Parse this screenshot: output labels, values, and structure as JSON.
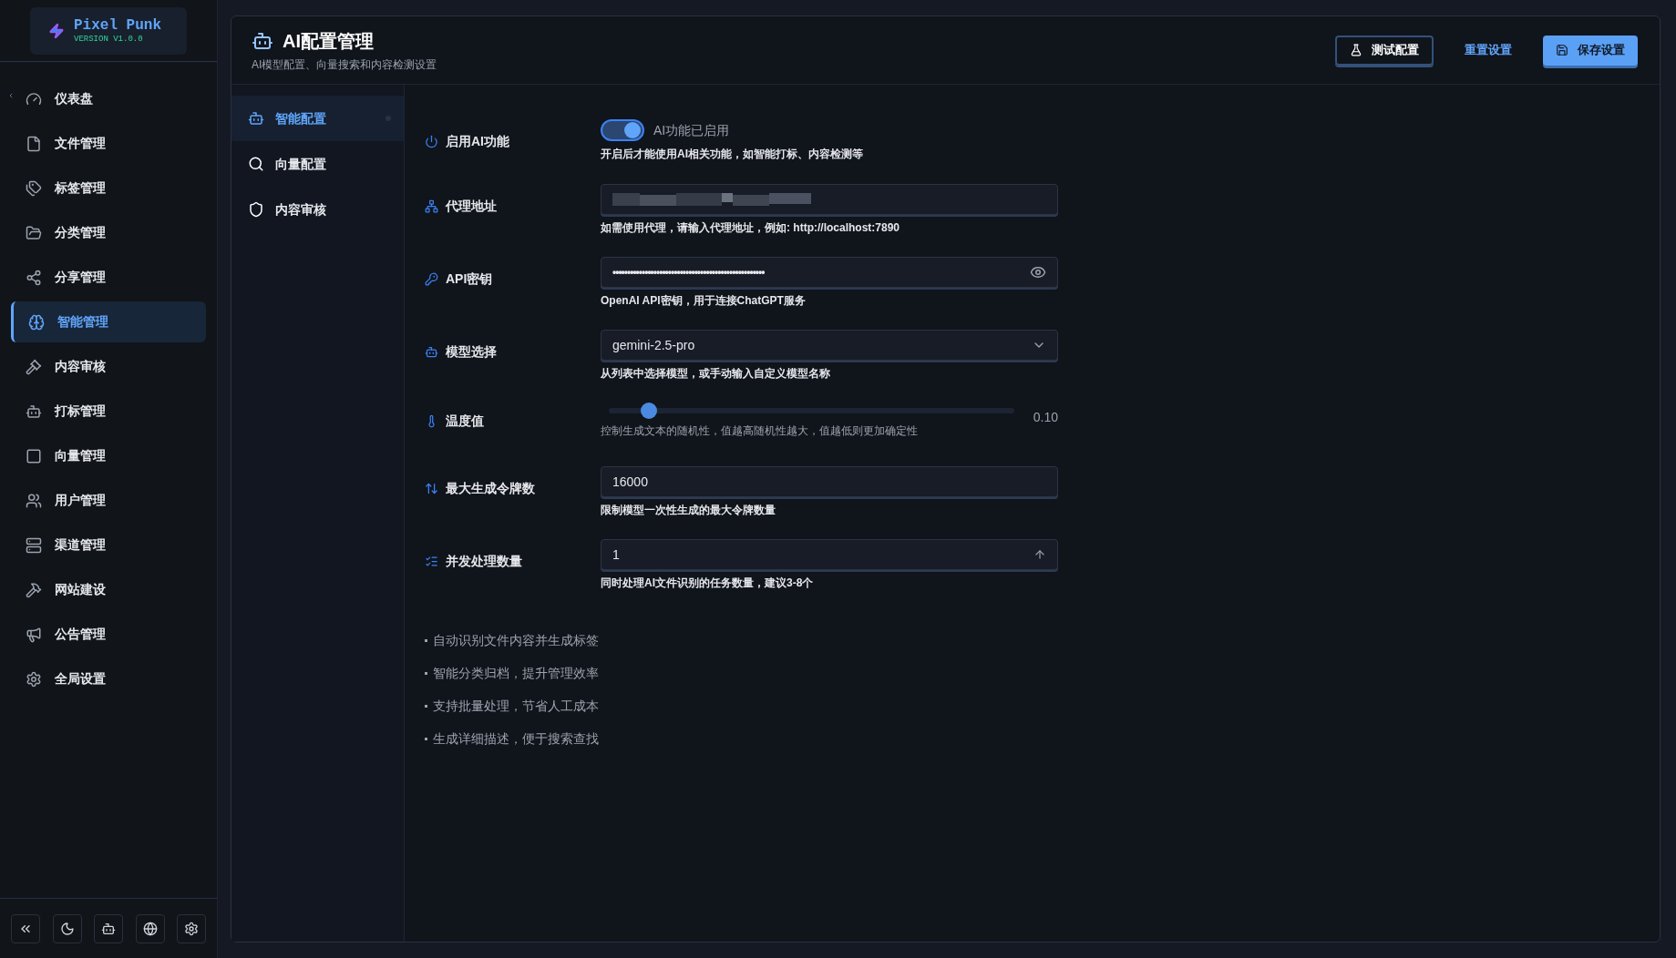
{
  "logo": {
    "name": "Pixel Punk",
    "version": "VERSION V1.0.0"
  },
  "sidebar": {
    "items": [
      {
        "label": "仪表盘",
        "selected": false
      },
      {
        "label": "文件管理",
        "selected": false
      },
      {
        "label": "标签管理",
        "selected": false
      },
      {
        "label": "分类管理",
        "selected": false
      },
      {
        "label": "分享管理",
        "selected": false
      },
      {
        "label": "智能管理",
        "selected": true
      },
      {
        "label": "内容审核",
        "selected": false
      },
      {
        "label": "打标管理",
        "selected": false
      },
      {
        "label": "向量管理",
        "selected": false
      },
      {
        "label": "用户管理",
        "selected": false
      },
      {
        "label": "渠道管理",
        "selected": false
      },
      {
        "label": "网站建设",
        "selected": false
      },
      {
        "label": "公告管理",
        "selected": false
      },
      {
        "label": "全局设置",
        "selected": false
      }
    ]
  },
  "header": {
    "title": "AI配置管理",
    "subtitle": "AI模型配置、向量搜索和内容检测设置",
    "buttons": [
      {
        "label": "测试配置",
        "kind": "outline"
      },
      {
        "label": "重置设置",
        "kind": "link"
      },
      {
        "label": "保存设置",
        "kind": "primary"
      }
    ]
  },
  "tabs": [
    {
      "label": "智能配置",
      "selected": true
    },
    {
      "label": "向量配置",
      "selected": false
    },
    {
      "label": "内容审核",
      "selected": false
    }
  ],
  "form": [
    {
      "kind": "toggle",
      "label": "启用AI功能",
      "on": true,
      "status": "AI功能已启用",
      "hint": "开启后才能使用AI相关功能，如智能打标、内容检测等"
    },
    {
      "kind": "redacted",
      "label": "代理地址",
      "hint": "如需使用代理，请输入代理地址，例如: http://localhost:7890"
    },
    {
      "kind": "password",
      "label": "API密钥",
      "value": "••••••••••••••••••••••••••••••••••••••••••••••••••••",
      "hint": "OpenAI API密钥，用于连接ChatGPT服务"
    },
    {
      "kind": "select",
      "label": "模型选择",
      "value": "gemini-2.5-pro",
      "hint": "从列表中选择模型，或手动输入自定义模型名称"
    },
    {
      "kind": "slider",
      "label": "温度值",
      "level": 0.1,
      "reading": "0.10",
      "hint": "控制生成文本的随机性，值越高随机性越大，值越低则更加确定性"
    },
    {
      "kind": "text",
      "label": "最大生成令牌数",
      "value": "16000",
      "hint": "限制模型一次性生成的最大令牌数量"
    },
    {
      "kind": "number",
      "label": "并发处理数量",
      "value": "1",
      "hint": "同时处理AI文件识别的任务数量，建议3-8个"
    }
  ],
  "features": [
    "自动识别文件内容并生成标签",
    "智能分类归档，提升管理效率",
    "支持批量处理，节省人工成本",
    "生成详细描述，便于搜索查找"
  ]
}
